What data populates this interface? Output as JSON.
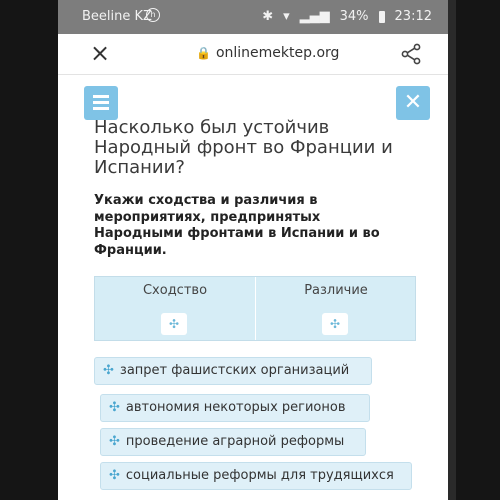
{
  "status_bar": {
    "carrier": "Beeline KZ",
    "battery": "34%",
    "time": "23:12"
  },
  "browser": {
    "url": "onlinemektep.org",
    "close_icon": "×"
  },
  "quiz": {
    "title": "Насколько был устойчив Народный фронт во Франции и Испании?",
    "instruction": "Укажи сходства и различия в мероприятиях, предпринятых Народными фронтами в Испании и во Франции.",
    "columns": [
      {
        "label": "Сходство"
      },
      {
        "label": "Различие"
      }
    ],
    "options": [
      {
        "label": "запрет фашистских организаций"
      },
      {
        "label": "автономия некоторых регионов"
      },
      {
        "label": "проведение аграрной реформы"
      },
      {
        "label": "социальные реформы для трудящихся"
      }
    ]
  },
  "colors": {
    "accent": "#7fc3e6",
    "drop_zone": "#d6edf6",
    "chip": "#dff0f8"
  }
}
